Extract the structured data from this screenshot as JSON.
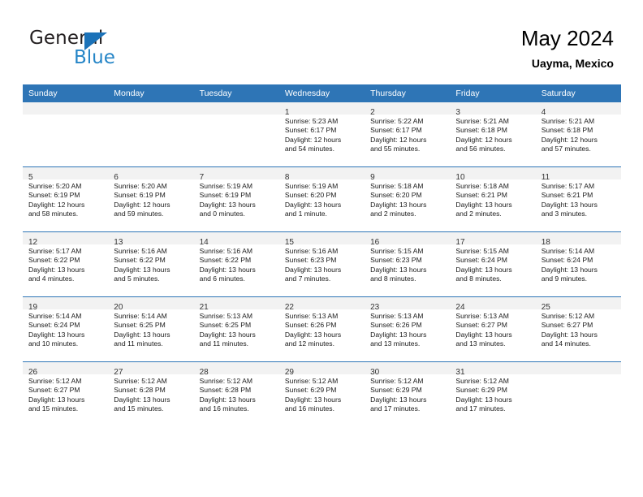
{
  "brand": {
    "name_top": "General",
    "name_bottom": "Blue",
    "accent_color": "#2585c7",
    "triangle_color": "#1b72b8"
  },
  "header": {
    "title": "May 2024",
    "subtitle": "Uayma, Mexico"
  },
  "theme": {
    "header_row_bg": "#2e75b6",
    "daynum_strip_bg": "#f2f2f2",
    "grid_line": "#2e75b6"
  },
  "weekdays": [
    "Sunday",
    "Monday",
    "Tuesday",
    "Wednesday",
    "Thursday",
    "Friday",
    "Saturday"
  ],
  "weeks": [
    [
      {
        "day": "",
        "empty": true
      },
      {
        "day": "",
        "empty": true
      },
      {
        "day": "",
        "empty": true
      },
      {
        "day": "1",
        "sunrise": "Sunrise: 5:23 AM",
        "sunset": "Sunset: 6:17 PM",
        "daylight1": "Daylight: 12 hours",
        "daylight2": "and 54 minutes."
      },
      {
        "day": "2",
        "sunrise": "Sunrise: 5:22 AM",
        "sunset": "Sunset: 6:17 PM",
        "daylight1": "Daylight: 12 hours",
        "daylight2": "and 55 minutes."
      },
      {
        "day": "3",
        "sunrise": "Sunrise: 5:21 AM",
        "sunset": "Sunset: 6:18 PM",
        "daylight1": "Daylight: 12 hours",
        "daylight2": "and 56 minutes."
      },
      {
        "day": "4",
        "sunrise": "Sunrise: 5:21 AM",
        "sunset": "Sunset: 6:18 PM",
        "daylight1": "Daylight: 12 hours",
        "daylight2": "and 57 minutes."
      }
    ],
    [
      {
        "day": "5",
        "sunrise": "Sunrise: 5:20 AM",
        "sunset": "Sunset: 6:19 PM",
        "daylight1": "Daylight: 12 hours",
        "daylight2": "and 58 minutes."
      },
      {
        "day": "6",
        "sunrise": "Sunrise: 5:20 AM",
        "sunset": "Sunset: 6:19 PM",
        "daylight1": "Daylight: 12 hours",
        "daylight2": "and 59 minutes."
      },
      {
        "day": "7",
        "sunrise": "Sunrise: 5:19 AM",
        "sunset": "Sunset: 6:19 PM",
        "daylight1": "Daylight: 13 hours",
        "daylight2": "and 0 minutes."
      },
      {
        "day": "8",
        "sunrise": "Sunrise: 5:19 AM",
        "sunset": "Sunset: 6:20 PM",
        "daylight1": "Daylight: 13 hours",
        "daylight2": "and 1 minute."
      },
      {
        "day": "9",
        "sunrise": "Sunrise: 5:18 AM",
        "sunset": "Sunset: 6:20 PM",
        "daylight1": "Daylight: 13 hours",
        "daylight2": "and 2 minutes."
      },
      {
        "day": "10",
        "sunrise": "Sunrise: 5:18 AM",
        "sunset": "Sunset: 6:21 PM",
        "daylight1": "Daylight: 13 hours",
        "daylight2": "and 2 minutes."
      },
      {
        "day": "11",
        "sunrise": "Sunrise: 5:17 AM",
        "sunset": "Sunset: 6:21 PM",
        "daylight1": "Daylight: 13 hours",
        "daylight2": "and 3 minutes."
      }
    ],
    [
      {
        "day": "12",
        "sunrise": "Sunrise: 5:17 AM",
        "sunset": "Sunset: 6:22 PM",
        "daylight1": "Daylight: 13 hours",
        "daylight2": "and 4 minutes."
      },
      {
        "day": "13",
        "sunrise": "Sunrise: 5:16 AM",
        "sunset": "Sunset: 6:22 PM",
        "daylight1": "Daylight: 13 hours",
        "daylight2": "and 5 minutes."
      },
      {
        "day": "14",
        "sunrise": "Sunrise: 5:16 AM",
        "sunset": "Sunset: 6:22 PM",
        "daylight1": "Daylight: 13 hours",
        "daylight2": "and 6 minutes."
      },
      {
        "day": "15",
        "sunrise": "Sunrise: 5:16 AM",
        "sunset": "Sunset: 6:23 PM",
        "daylight1": "Daylight: 13 hours",
        "daylight2": "and 7 minutes."
      },
      {
        "day": "16",
        "sunrise": "Sunrise: 5:15 AM",
        "sunset": "Sunset: 6:23 PM",
        "daylight1": "Daylight: 13 hours",
        "daylight2": "and 8 minutes."
      },
      {
        "day": "17",
        "sunrise": "Sunrise: 5:15 AM",
        "sunset": "Sunset: 6:24 PM",
        "daylight1": "Daylight: 13 hours",
        "daylight2": "and 8 minutes."
      },
      {
        "day": "18",
        "sunrise": "Sunrise: 5:14 AM",
        "sunset": "Sunset: 6:24 PM",
        "daylight1": "Daylight: 13 hours",
        "daylight2": "and 9 minutes."
      }
    ],
    [
      {
        "day": "19",
        "sunrise": "Sunrise: 5:14 AM",
        "sunset": "Sunset: 6:24 PM",
        "daylight1": "Daylight: 13 hours",
        "daylight2": "and 10 minutes."
      },
      {
        "day": "20",
        "sunrise": "Sunrise: 5:14 AM",
        "sunset": "Sunset: 6:25 PM",
        "daylight1": "Daylight: 13 hours",
        "daylight2": "and 11 minutes."
      },
      {
        "day": "21",
        "sunrise": "Sunrise: 5:13 AM",
        "sunset": "Sunset: 6:25 PM",
        "daylight1": "Daylight: 13 hours",
        "daylight2": "and 11 minutes."
      },
      {
        "day": "22",
        "sunrise": "Sunrise: 5:13 AM",
        "sunset": "Sunset: 6:26 PM",
        "daylight1": "Daylight: 13 hours",
        "daylight2": "and 12 minutes."
      },
      {
        "day": "23",
        "sunrise": "Sunrise: 5:13 AM",
        "sunset": "Sunset: 6:26 PM",
        "daylight1": "Daylight: 13 hours",
        "daylight2": "and 13 minutes."
      },
      {
        "day": "24",
        "sunrise": "Sunrise: 5:13 AM",
        "sunset": "Sunset: 6:27 PM",
        "daylight1": "Daylight: 13 hours",
        "daylight2": "and 13 minutes."
      },
      {
        "day": "25",
        "sunrise": "Sunrise: 5:12 AM",
        "sunset": "Sunset: 6:27 PM",
        "daylight1": "Daylight: 13 hours",
        "daylight2": "and 14 minutes."
      }
    ],
    [
      {
        "day": "26",
        "sunrise": "Sunrise: 5:12 AM",
        "sunset": "Sunset: 6:27 PM",
        "daylight1": "Daylight: 13 hours",
        "daylight2": "and 15 minutes."
      },
      {
        "day": "27",
        "sunrise": "Sunrise: 5:12 AM",
        "sunset": "Sunset: 6:28 PM",
        "daylight1": "Daylight: 13 hours",
        "daylight2": "and 15 minutes."
      },
      {
        "day": "28",
        "sunrise": "Sunrise: 5:12 AM",
        "sunset": "Sunset: 6:28 PM",
        "daylight1": "Daylight: 13 hours",
        "daylight2": "and 16 minutes."
      },
      {
        "day": "29",
        "sunrise": "Sunrise: 5:12 AM",
        "sunset": "Sunset: 6:29 PM",
        "daylight1": "Daylight: 13 hours",
        "daylight2": "and 16 minutes."
      },
      {
        "day": "30",
        "sunrise": "Sunrise: 5:12 AM",
        "sunset": "Sunset: 6:29 PM",
        "daylight1": "Daylight: 13 hours",
        "daylight2": "and 17 minutes."
      },
      {
        "day": "31",
        "sunrise": "Sunrise: 5:12 AM",
        "sunset": "Sunset: 6:29 PM",
        "daylight1": "Daylight: 13 hours",
        "daylight2": "and 17 minutes."
      },
      {
        "day": "",
        "empty": true
      }
    ]
  ]
}
